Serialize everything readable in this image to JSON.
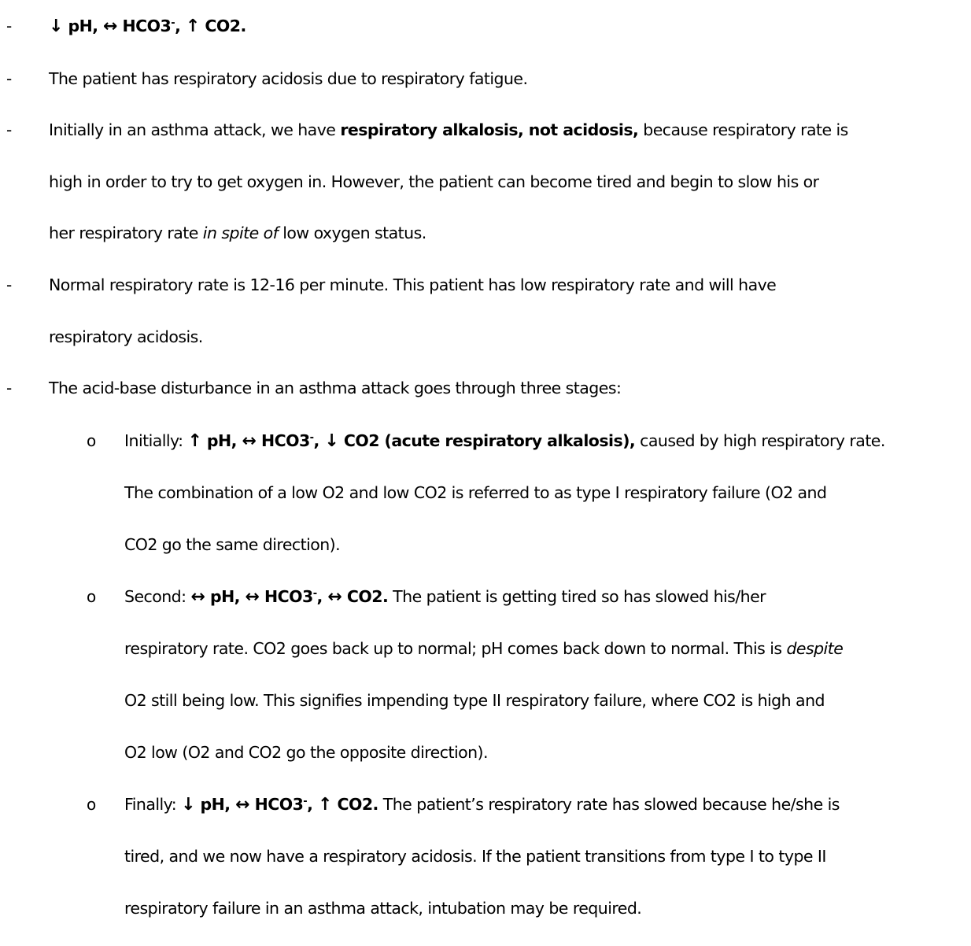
{
  "bullets": {
    "dash": "-",
    "circle": "o"
  },
  "lines": [
    [
      {
        "t": "↓",
        "s": "b arr"
      },
      {
        "t": " pH, ",
        "s": "b"
      },
      {
        "t": "↔",
        "s": "b arr"
      },
      {
        "t": " HCO3",
        "s": "b"
      },
      {
        "t": "-",
        "s": "b sup"
      },
      {
        "t": ", ",
        "s": "b"
      },
      {
        "t": "↑",
        "s": "b arr"
      },
      {
        "t": " CO2.",
        "s": "b"
      }
    ],
    [
      {
        "t": "The patient has respiratory acidosis due to respiratory fatigue.",
        "s": ""
      }
    ],
    [
      {
        "t": "Initially in an asthma attack, we have ",
        "s": ""
      },
      {
        "t": "respiratory alkalosis, not acidosis,",
        "s": "b"
      },
      {
        "t": " because respiratory rate is",
        "s": ""
      }
    ],
    [
      {
        "t": "high in order to try to get oxygen in. However, the patient can become tired and begin to slow his or",
        "s": ""
      }
    ],
    [
      {
        "t": "her respiratory rate ",
        "s": ""
      },
      {
        "t": "in spite of",
        "s": "i"
      },
      {
        "t": " low oxygen status.",
        "s": ""
      }
    ],
    [
      {
        "t": "Normal respiratory rate is 12-16 per minute. This patient has low respiratory rate and will have",
        "s": ""
      }
    ],
    [
      {
        "t": "respiratory acidosis.",
        "s": ""
      }
    ],
    [
      {
        "t": "The acid-base disturbance in an asthma attack goes through three stages:",
        "s": ""
      }
    ],
    [
      {
        "t": "Initially: ",
        "s": ""
      },
      {
        "t": "↑",
        "s": "b arr"
      },
      {
        "t": " pH, ",
        "s": "b"
      },
      {
        "t": "↔",
        "s": "b arr"
      },
      {
        "t": " HCO3",
        "s": "b"
      },
      {
        "t": "-",
        "s": "b sup"
      },
      {
        "t": ", ",
        "s": "b"
      },
      {
        "t": "↓",
        "s": "b arr"
      },
      {
        "t": " CO2 (acute respiratory alkalosis),",
        "s": "b"
      },
      {
        "t": " caused by high respiratory rate.",
        "s": ""
      }
    ],
    [
      {
        "t": "The combination of a low O2 and low CO2 is referred to as type I respiratory failure (O2 and",
        "s": ""
      }
    ],
    [
      {
        "t": "CO2 go the same direction).",
        "s": ""
      }
    ],
    [
      {
        "t": "Second: ",
        "s": ""
      },
      {
        "t": "↔",
        "s": "b arr"
      },
      {
        "t": " pH, ",
        "s": "b"
      },
      {
        "t": "↔",
        "s": "b arr"
      },
      {
        "t": " HCO3",
        "s": "b"
      },
      {
        "t": "-",
        "s": "b sup"
      },
      {
        "t": ", ",
        "s": "b"
      },
      {
        "t": "↔",
        "s": "b arr"
      },
      {
        "t": " CO2.",
        "s": "b"
      },
      {
        "t": " The patient is getting tired so has slowed his/her",
        "s": ""
      }
    ],
    [
      {
        "t": "respiratory rate. CO2 goes back up to normal; pH comes back down to normal. This is ",
        "s": ""
      },
      {
        "t": "despite",
        "s": "i"
      }
    ],
    [
      {
        "t": "O2 still being low. This signifies impending type II respiratory failure, where CO2 is high and",
        "s": ""
      }
    ],
    [
      {
        "t": "O2 low (O2 and CO2 go the opposite direction).",
        "s": ""
      }
    ],
    [
      {
        "t": "Finally: ",
        "s": ""
      },
      {
        "t": "↓",
        "s": "b arr"
      },
      {
        "t": " pH, ",
        "s": "b"
      },
      {
        "t": "↔",
        "s": "b arr"
      },
      {
        "t": " HCO3",
        "s": "b"
      },
      {
        "t": "-",
        "s": "b sup"
      },
      {
        "t": ", ",
        "s": "b"
      },
      {
        "t": "↑",
        "s": "b arr"
      },
      {
        "t": " CO2.",
        "s": "b"
      },
      {
        "t": " The patient’s respiratory rate has slowed because he/she is",
        "s": ""
      }
    ],
    [
      {
        "t": "tired, and we now have a respiratory acidosis. If the patient transitions from type I to type II",
        "s": ""
      }
    ],
    [
      {
        "t": "respiratory failure in an asthma attack, intubation may be required.",
        "s": ""
      }
    ]
  ]
}
